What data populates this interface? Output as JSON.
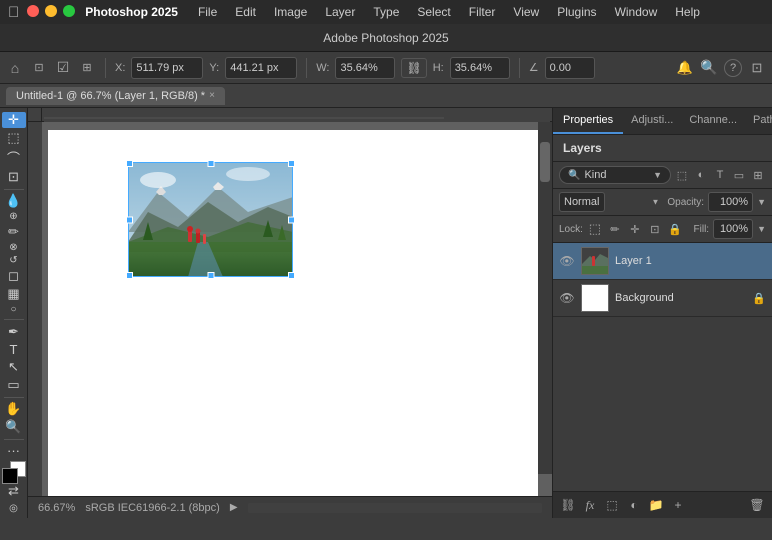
{
  "menubar": {
    "app_name": "Photoshop 2025",
    "menus": [
      "File",
      "Edit",
      "Image",
      "Layer",
      "Type",
      "Select",
      "Filter",
      "View",
      "Plugins",
      "Window",
      "Help"
    ]
  },
  "titlebar": {
    "title": "Adobe Photoshop 2025"
  },
  "optionsbar": {
    "x_label": "X:",
    "x_value": "511.79 px",
    "y_label": "Y:",
    "y_value": "441.21 px",
    "w_label": "W:",
    "w_value": "35.64%",
    "h_label": "H:",
    "h_value": "35.64%",
    "angle_value": "0.00"
  },
  "tab": {
    "title": "Untitled-1 @ 66.7% (Layer 1, RGB/8) *",
    "close": "×"
  },
  "canvas": {
    "zoom": "66.67%",
    "color_profile": "sRGB IEC61966-2.1 (8bpc)"
  },
  "panels": {
    "properties": "Properties",
    "adjustments": "Adjusti...",
    "channels": "Channe...",
    "paths": "Paths"
  },
  "layers": {
    "title": "Layers",
    "filter_placeholder": "Kind",
    "blend_mode": "Normal",
    "opacity_label": "Opacity:",
    "opacity_value": "100%",
    "lock_label": "Lock:",
    "fill_label": "Fill:",
    "fill_value": "100%",
    "items": [
      {
        "name": "Layer 1",
        "visible": true,
        "selected": true,
        "has_content": true,
        "locked": false
      },
      {
        "name": "Background",
        "visible": true,
        "selected": false,
        "has_content": false,
        "locked": true
      }
    ],
    "bottom_buttons": [
      "link-icon",
      "fx-icon",
      "mask-icon",
      "adjustment-icon",
      "folder-icon",
      "new-layer-icon",
      "delete-icon"
    ]
  }
}
